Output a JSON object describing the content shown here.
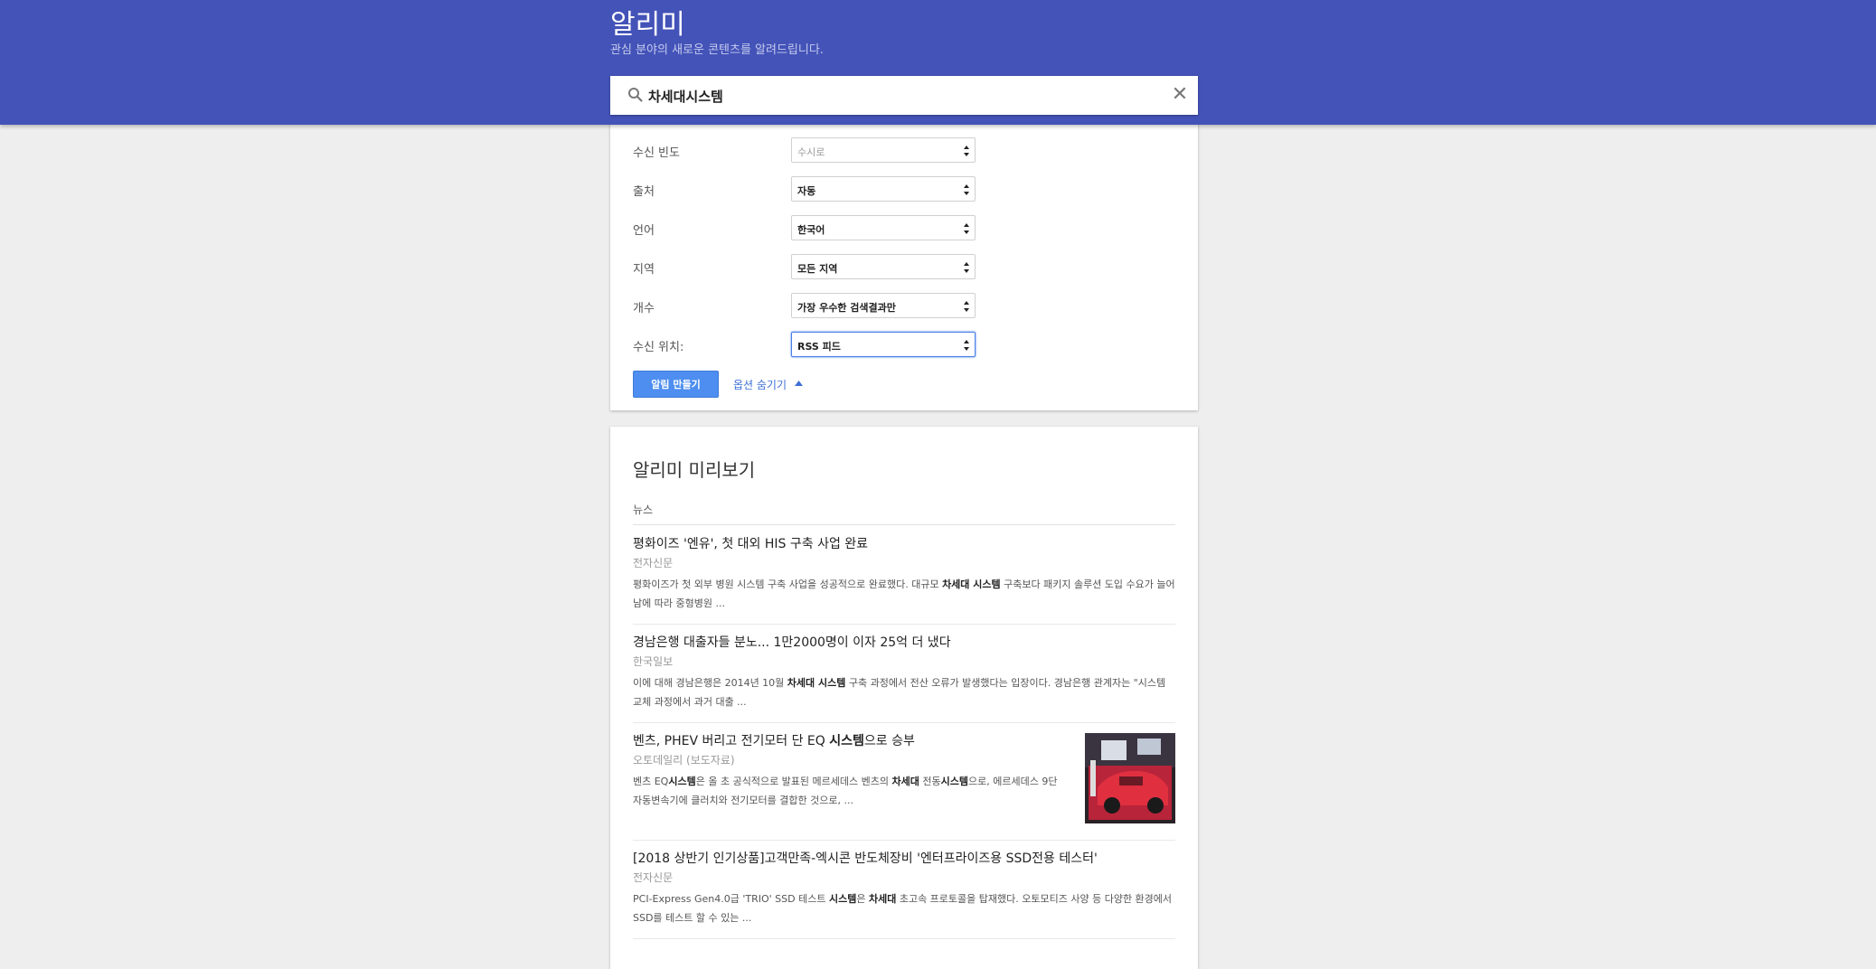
{
  "header": {
    "title": "알리미",
    "subtitle": "관심 분야의 새로운 콘텐츠를 알려드립니다."
  },
  "search": {
    "value": "차세대시스템",
    "clear_label": "✕"
  },
  "options": {
    "rows": [
      {
        "label": "수신 빈도",
        "value": "수시로"
      },
      {
        "label": "출처",
        "value": "자동"
      },
      {
        "label": "언어",
        "value": "한국어"
      },
      {
        "label": "지역",
        "value": "모든 지역"
      },
      {
        "label": "개수",
        "value": "가장 우수한 검색결과만"
      },
      {
        "label": "수신 위치:",
        "value": "RSS 피드"
      }
    ],
    "create_button": "알림 만들기",
    "hide_options": "옵션 숨기기"
  },
  "preview": {
    "title": "알리미 미리보기",
    "section": "뉴스",
    "items": [
      {
        "title": "평화이즈 '엔유', 첫 대외 HIS 구축 사업 완료",
        "source": "전자신문",
        "snippet_1": "평화이즈가 첫 외부 병원 시스템 구축 사업을 성공적으로 완료했다. 대규모 ",
        "snippet_bold_1": "차세대 시스템",
        "snippet_2": " 구축보다 패키지 솔루션 도입 수요가 늘어남에 따라 중형병원 ..."
      },
      {
        "title": "경남은행 대출자들 분노... 1만2000명이 이자 25억 더 냈다",
        "source": "한국일보",
        "snippet_1": "이에 대해 경남은행은 2014년 10월 ",
        "snippet_bold_1": "차세대 시스템",
        "snippet_2": " 구축 과정에서 전산 오류가 발생했다는 입장이다. 경남은행 관계자는 \"시스템 교체 과정에서 과거 대출 ..."
      },
      {
        "title_1": "벤츠, PHEV 버리고 전기모터 단 EQ ",
        "title_bold": "시스템",
        "title_2": "으로 승부",
        "source": "오토데일리 (보도자료)",
        "snippet_1": "벤츠 EQ",
        "snippet_bold_1": "시스템",
        "snippet_2": "은 올 초 공식적으로 발표된 메르세데스 벤츠의 ",
        "snippet_bold_2": "차세대",
        "snippet_3": " 전동",
        "snippet_bold_3": "시스템",
        "snippet_4": "으로, 에르세데스 9단 자동변속기에 클러치와 전기모터를 결합한 것으로, ..."
      },
      {
        "title": "[2018 상반기 인기상품]고객만족-엑시콘 반도체장비 '엔터프라이즈용 SSD전용 테스터'",
        "source": "전자신문",
        "snippet_1": "PCI-Express Gen4.0급 'TRIO' SSD 테스트 ",
        "snippet_bold_1": "시스템",
        "snippet_2": "은 ",
        "snippet_bold_2": "차세대",
        "snippet_3": " 초고속 프로토콜을 탑재했다. 오토모티즈 사양 등 다양한 환경에서 SSD를 테스트 할 수 있는 ..."
      }
    ]
  }
}
